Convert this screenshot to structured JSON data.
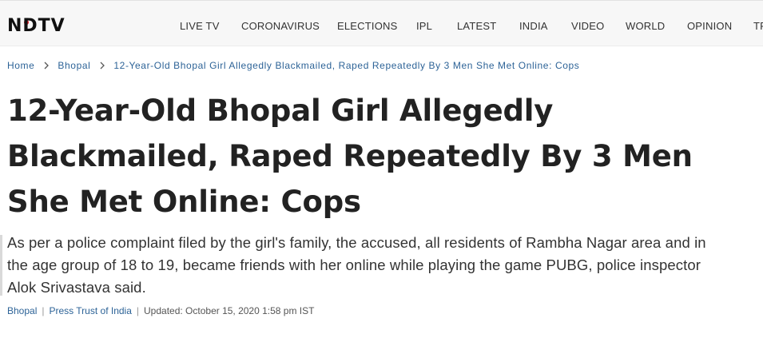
{
  "header": {
    "logo": "NDTV",
    "nav": [
      "LIVE TV",
      "CORONAVIRUS",
      "ELECTIONS",
      "IPL",
      "LATEST",
      "INDIA",
      "VIDEO",
      "WORLD",
      "OPINION",
      "TR"
    ]
  },
  "breadcrumb": {
    "home": "Home",
    "section": "Bhopal",
    "current": "12-Year-Old Bhopal Girl Allegedly Blackmailed, Raped Repeatedly By 3 Men She Met Online: Cops"
  },
  "article": {
    "headline": "12-Year-Old Bhopal Girl Allegedly Blackmailed, Raped Repeatedly By 3 Men She Met Online: Cops",
    "summary": "As per a police complaint filed by the girl's family, the accused, all residents of Rambha Nagar area and in the age group of 18 to 19, became friends with her online while playing the game PUBG, police inspector Alok Srivastava said.",
    "byline": {
      "location": "Bhopal",
      "source": "Press Trust of India",
      "updated": "Updated: October 15, 2020 1:58 pm IST"
    }
  },
  "colors": {
    "accent": "#e41e26",
    "link": "#2d6397",
    "topbar": "#f7f7f7"
  }
}
